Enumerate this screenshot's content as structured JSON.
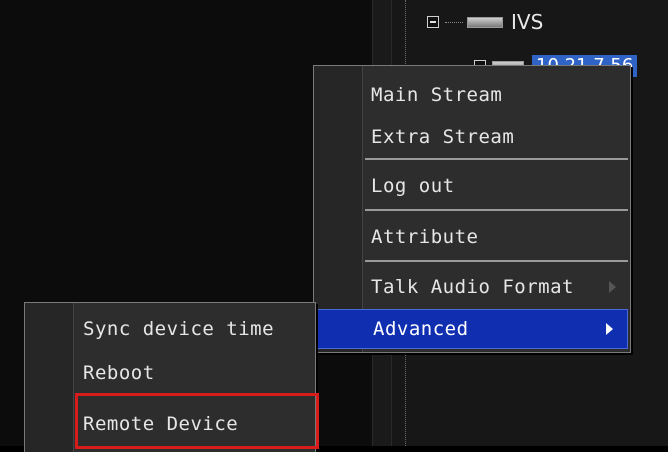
{
  "tree": {
    "group_label": "IVS",
    "device_ip": "10.21.7.56"
  },
  "context_menu": {
    "items": [
      {
        "label": "Main Stream"
      },
      {
        "label": "Extra Stream"
      },
      {
        "label": "Log out"
      },
      {
        "label": "Attribute"
      },
      {
        "label": "Talk Audio Format"
      },
      {
        "label": "Advanced"
      }
    ]
  },
  "submenu": {
    "items": [
      {
        "label": "Sync device time"
      },
      {
        "label": "Reboot"
      },
      {
        "label": "Remote Device"
      }
    ]
  },
  "colors": {
    "selection": "#0f2fb0",
    "highlight_box": "#d81c1c",
    "tree_selection": "#2f63c6"
  }
}
